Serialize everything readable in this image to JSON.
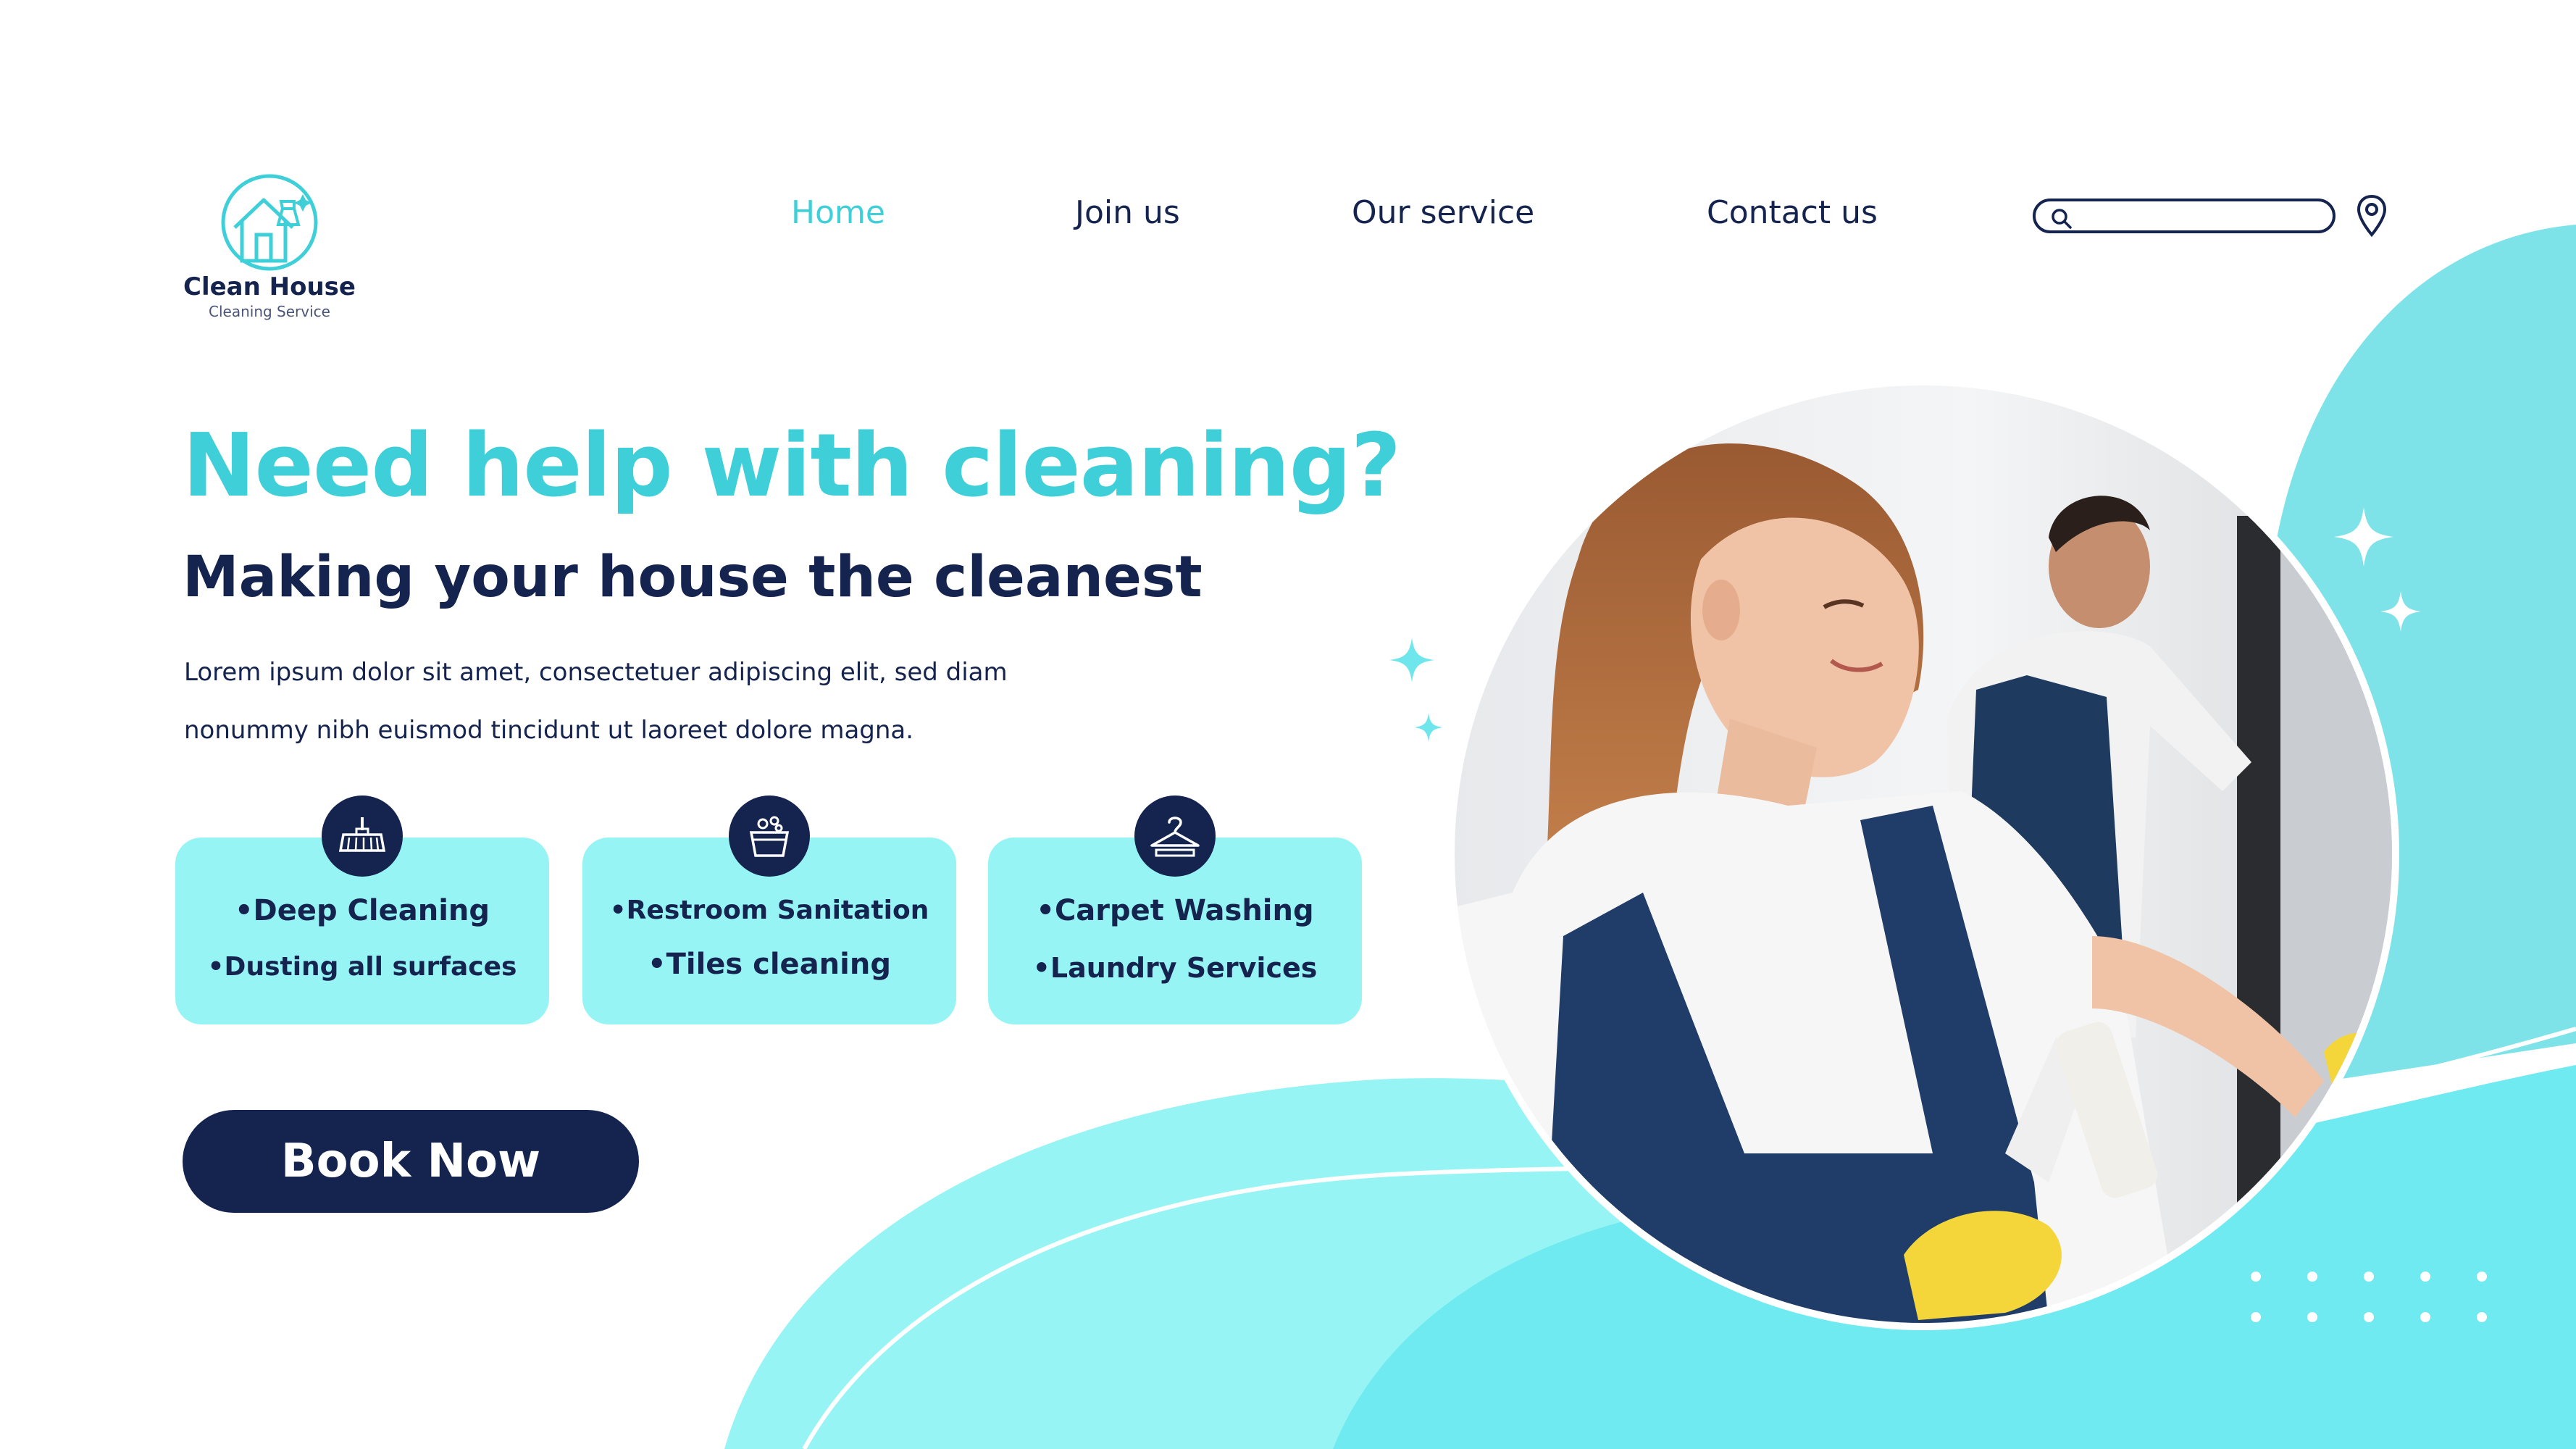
{
  "brand": {
    "name": "Clean House",
    "tagline": "Cleaning Service"
  },
  "nav": {
    "items": [
      {
        "label": "Home",
        "active": true
      },
      {
        "label": "Join us",
        "active": false
      },
      {
        "label": "Our service",
        "active": false
      },
      {
        "label": "Contact us",
        "active": false
      }
    ]
  },
  "search": {
    "placeholder": "",
    "value": ""
  },
  "icons": {
    "search": "search-icon",
    "location": "location-pin-icon",
    "logo": "house-spray-logo-icon",
    "card1": "broom-icon",
    "card2": "bucket-icon",
    "card3": "hanger-icon"
  },
  "hero": {
    "title": "Need help with cleaning?",
    "subtitle": "Making your house the cleanest",
    "body_line1": "Lorem ipsum dolor sit amet, consectetuer adipiscing elit, sed diam",
    "body_line2": "nonummy nibh euismod tincidunt ut laoreet dolore magna."
  },
  "services": [
    {
      "line1": "•Deep Cleaning",
      "line2": "•Dusting all surfaces"
    },
    {
      "line1": "•Restroom Sanitation",
      "line2": "•Tiles cleaning"
    },
    {
      "line1": "•Carpet Washing",
      "line2": "•Laundry Services"
    }
  ],
  "cta": {
    "label": "Book Now"
  },
  "colors": {
    "accent": "#3ecfd8",
    "navy": "#15244f",
    "card_bg": "#97f4f4",
    "wave_light": "#97f4f4",
    "wave_mid": "#6eeaf0",
    "wave_right": "#7ee3e8"
  }
}
